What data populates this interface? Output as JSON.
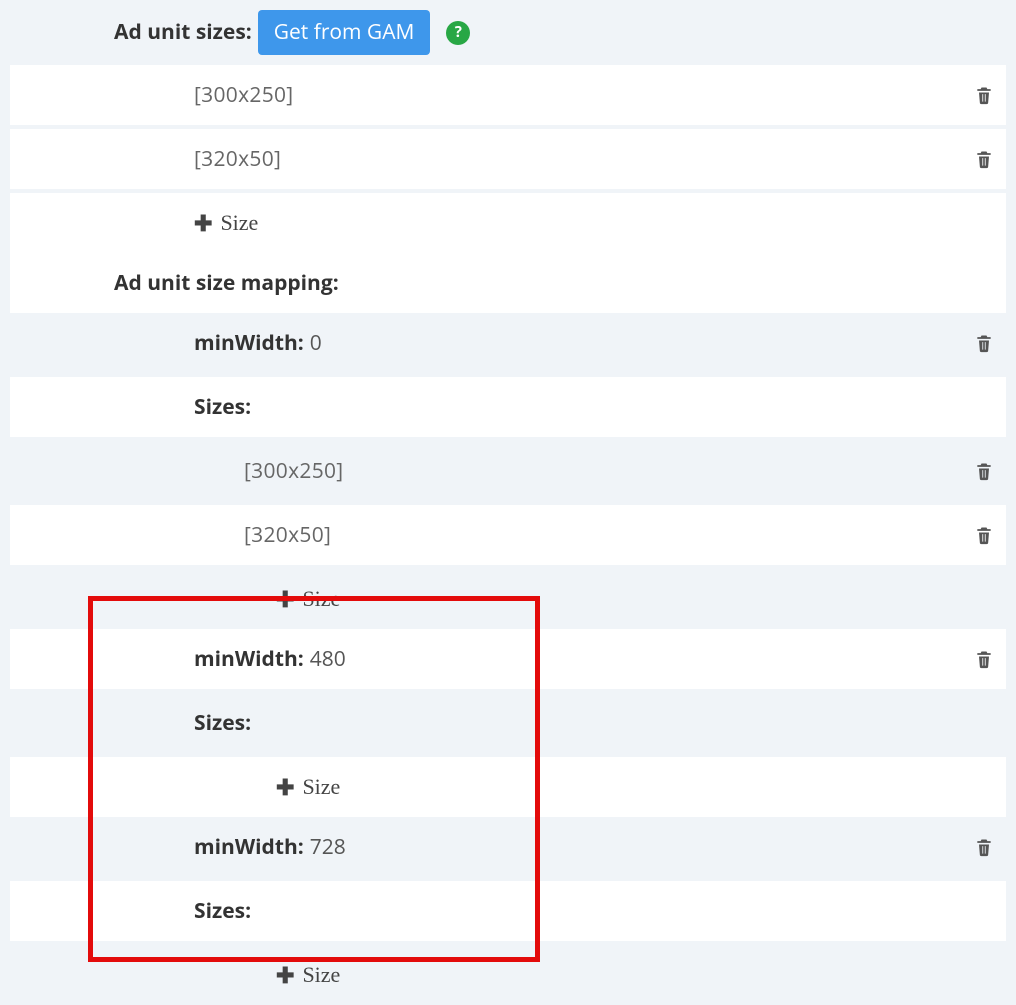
{
  "section_ad_unit_sizes": {
    "label": "Ad unit sizes:",
    "button": "Get from GAM",
    "sizes": [
      "[300x250]",
      "[320x50]"
    ],
    "add_label": "Size"
  },
  "section_mapping": {
    "label": "Ad unit size mapping:",
    "breakpoints": [
      {
        "min_width_label": "minWidth:",
        "min_width_value": "0",
        "sizes_label": "Sizes:",
        "sizes": [
          "[300x250]",
          "[320x50]"
        ],
        "add_label": "Size"
      },
      {
        "min_width_label": "minWidth:",
        "min_width_value": "480",
        "sizes_label": "Sizes:",
        "sizes": [],
        "add_label": "Size"
      },
      {
        "min_width_label": "minWidth:",
        "min_width_value": "728",
        "sizes_label": "Sizes:",
        "sizes": [],
        "add_label": "Size"
      }
    ]
  }
}
